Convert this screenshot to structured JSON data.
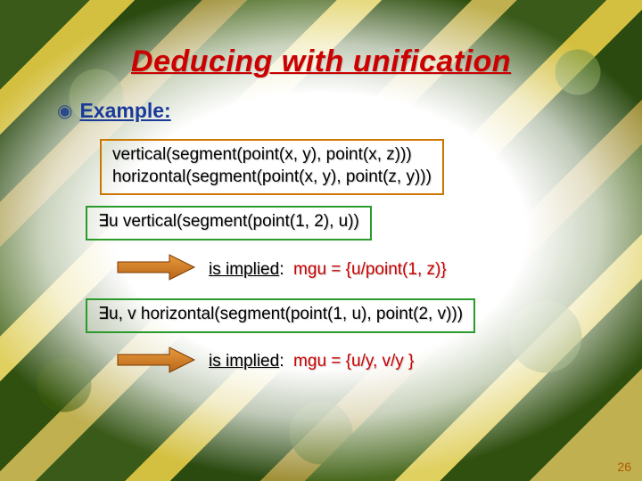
{
  "title": "Deducing with unification",
  "example_label": "Example:",
  "orange_box_line1": "vertical(segment(point(x, y), point(x, z)))",
  "orange_box_line2": "horizontal(segment(point(x, y), point(z, y)))",
  "green_box_1": "∃u vertical(segment(point(1, 2), u))",
  "result1_label": "is implied",
  "result1_colon": ":",
  "result1_mgu": "mgu = {u/point(1, z)}",
  "green_box_2": "∃u, v horizontal(segment(point(1, u), point(2, v)))",
  "result2_label": "is implied",
  "result2_colon": ":",
  "result2_mgu": "mgu = {u/y, v/y }",
  "page_number": "26"
}
